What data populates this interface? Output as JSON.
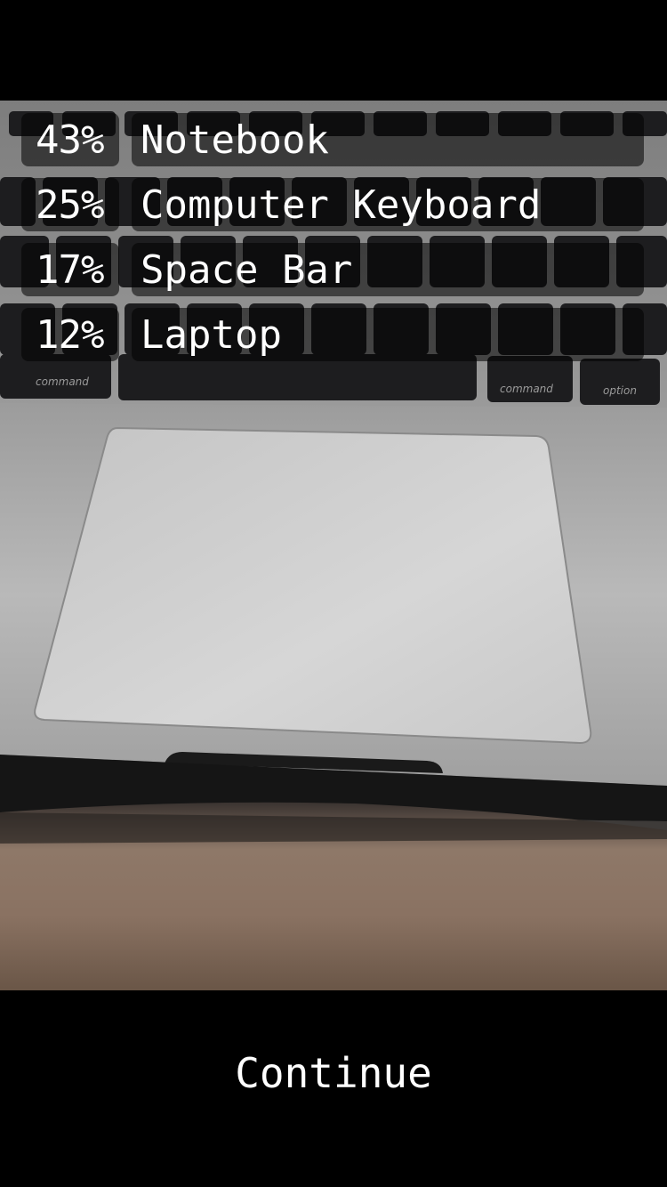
{
  "predictions": [
    {
      "percent": "43%",
      "label": "Notebook"
    },
    {
      "percent": "25%",
      "label": "Computer Keyboard"
    },
    {
      "percent": "17%",
      "label": "Space Bar"
    },
    {
      "percent": "12%",
      "label": "Laptop"
    }
  ],
  "actions": {
    "continue_label": "Continue"
  },
  "camera_view": {
    "keyboard_keys": [
      "command",
      "command",
      "option"
    ]
  },
  "colors": {
    "background": "#000000",
    "text": "#ffffff",
    "overlay": "rgba(0,0,0,0.55)"
  }
}
